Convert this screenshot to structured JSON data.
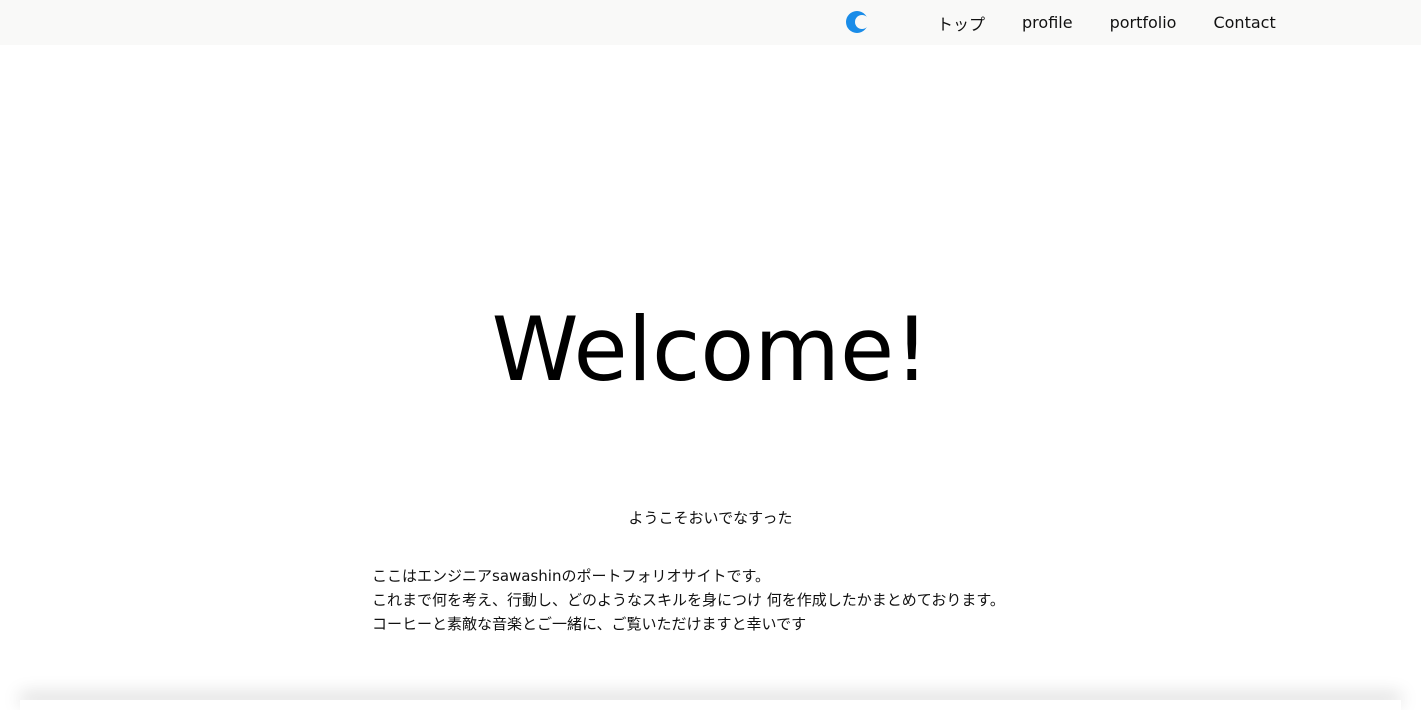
{
  "header": {
    "theme_toggle_icon": "crescent-moon-icon",
    "accent_color": "#1a8ce8",
    "nav": [
      {
        "label": "トップ"
      },
      {
        "label": "profile"
      },
      {
        "label": "portfolio"
      },
      {
        "label": "Contact"
      }
    ]
  },
  "hero": {
    "title": "Welcome!",
    "greeting": "ようこそおいでなすった",
    "intro_lines": [
      "ここはエンジニアsawashinのポートフォリオサイトです。",
      "これまで何を考え、行動し、どのようなスキルを身につけ 何を作成したかまとめております。",
      "コーヒーと素敵な音楽とご一緒に、ご覧いただけますと幸いです"
    ]
  }
}
